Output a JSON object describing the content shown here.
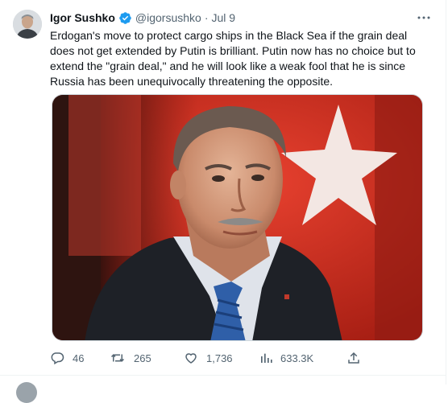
{
  "tweet": {
    "author_name": "Igor Sushko",
    "author_handle": "@igorsushko",
    "separator": "·",
    "date": "Jul 9",
    "text": "Erdogan's move to protect cargo ships in the Black Sea if the grain deal does not get extended by Putin is brilliant. Putin now has no choice but to extend the \"grain deal,\" and he will look like a weak fool that he is since Russia has been unequivocally threatening the opposite.",
    "verified_color": "#1d9bf0"
  },
  "actions": {
    "replies": "46",
    "reposts": "265",
    "likes": "1,736",
    "views": "633.3K"
  },
  "icons": {
    "verified": "verified-badge-icon",
    "more": "more-icon",
    "reply": "reply-icon",
    "repost": "repost-icon",
    "like": "heart-icon",
    "views": "views-icon",
    "share": "share-icon"
  }
}
